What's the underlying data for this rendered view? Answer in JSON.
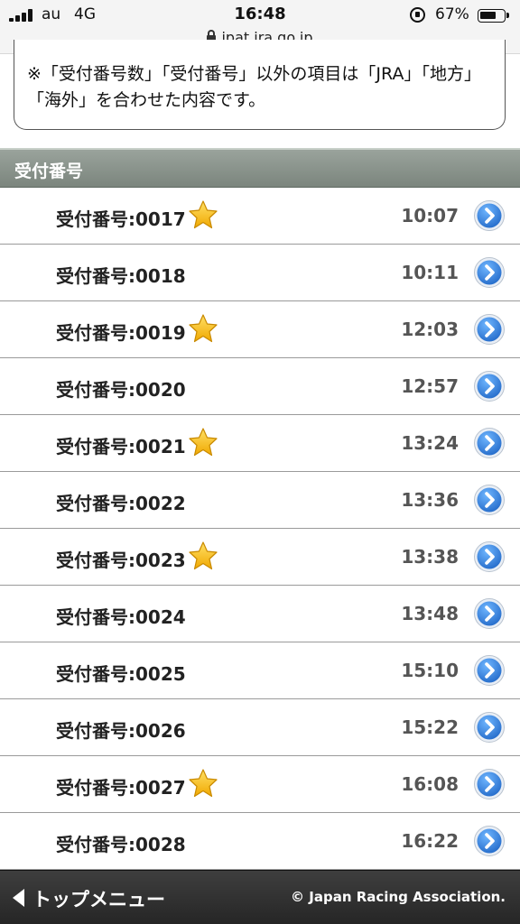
{
  "status_bar": {
    "carrier": "au",
    "network": "4G",
    "time": "16:48",
    "battery_percent": "67%",
    "battery_level": 0.67,
    "url": "ipat.jra.go.jp"
  },
  "notice": {
    "text": "※「受付番号数」「受付番号」以外の項目は「JRA」「地方」「海外」を合わせた内容です。"
  },
  "section": {
    "title": "受付番号"
  },
  "receipts": [
    {
      "label": "受付番号:0017",
      "time": "10:07",
      "starred": true
    },
    {
      "label": "受付番号:0018",
      "time": "10:11",
      "starred": false
    },
    {
      "label": "受付番号:0019",
      "time": "12:03",
      "starred": true
    },
    {
      "label": "受付番号:0020",
      "time": "12:57",
      "starred": false
    },
    {
      "label": "受付番号:0021",
      "time": "13:24",
      "starred": true
    },
    {
      "label": "受付番号:0022",
      "time": "13:36",
      "starred": false
    },
    {
      "label": "受付番号:0023",
      "time": "13:38",
      "starred": true
    },
    {
      "label": "受付番号:0024",
      "time": "13:48",
      "starred": false
    },
    {
      "label": "受付番号:0025",
      "time": "15:10",
      "starred": false
    },
    {
      "label": "受付番号:0026",
      "time": "15:22",
      "starred": false
    },
    {
      "label": "受付番号:0027",
      "time": "16:08",
      "starred": true
    },
    {
      "label": "受付番号:0028",
      "time": "16:22",
      "starred": false
    }
  ],
  "footer": {
    "back_label": "トップメニュー",
    "copyright": "© Japan Racing Association."
  },
  "colors": {
    "header_bg": "#8a948c",
    "footer_bg": "#2e2e2e",
    "button_blue": "#2f7fd9",
    "star_gold": "#f5b800"
  }
}
